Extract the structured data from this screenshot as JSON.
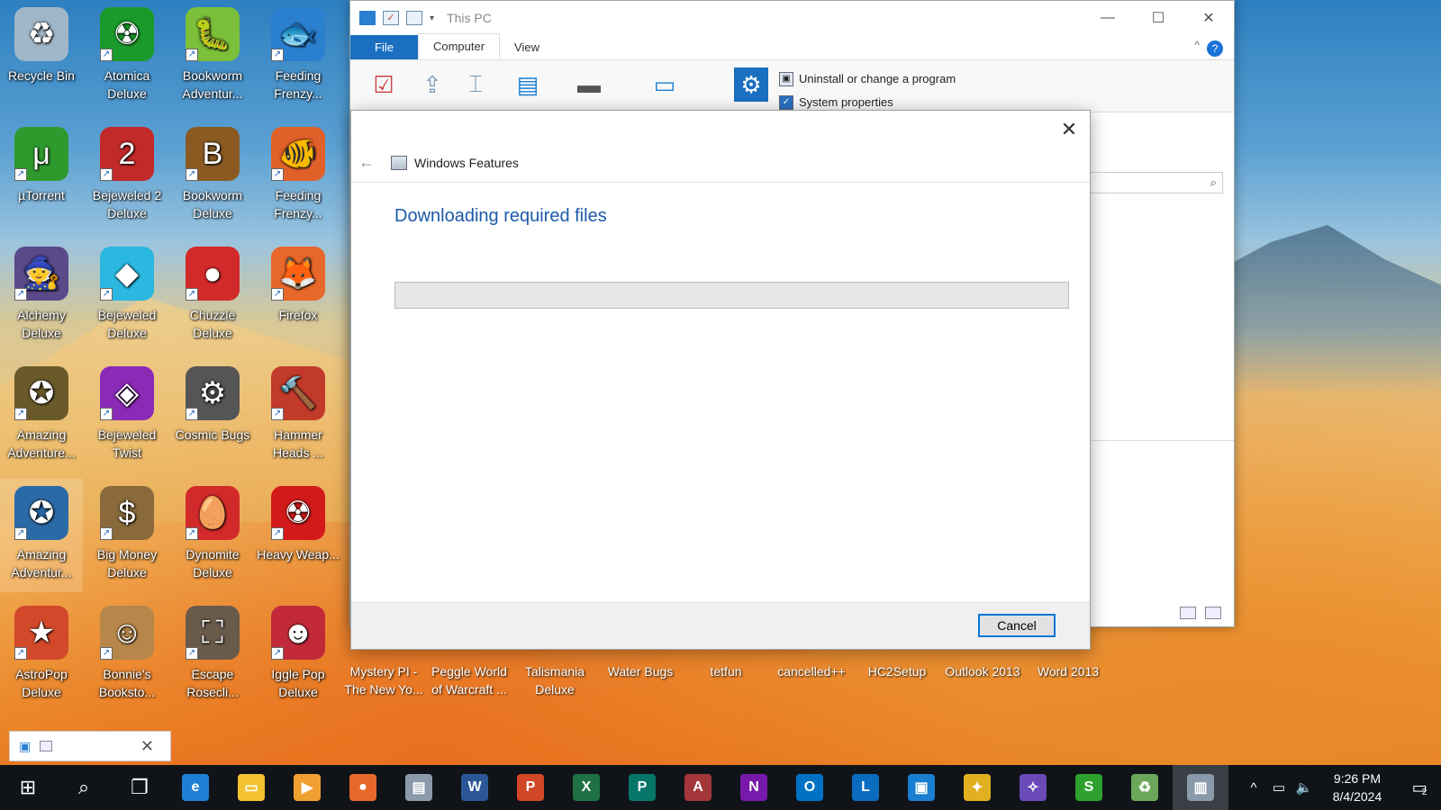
{
  "desktop": {
    "icons": [
      {
        "label": "Recycle Bin",
        "icon": "recycle-bin-icon",
        "color": "#9fb7c9",
        "glyph": "♻",
        "shortcut": false
      },
      {
        "label": "Atomica Deluxe",
        "icon": "atomica-icon",
        "color": "#1a9a2a",
        "glyph": "☢",
        "shortcut": true
      },
      {
        "label": "Bookworm Adventur...",
        "icon": "bookworm-adventures-icon",
        "color": "#7bbf3a",
        "glyph": "🐛",
        "shortcut": true
      },
      {
        "label": "Feeding Frenzy...",
        "icon": "feeding-frenzy-icon",
        "color": "#2a7fcf",
        "glyph": "🐟",
        "shortcut": true
      },
      {
        "label": "µTorrent",
        "icon": "utorrent-icon",
        "color": "#2e9a2e",
        "glyph": "μ",
        "shortcut": true
      },
      {
        "label": "Bejeweled 2 Deluxe",
        "icon": "bejeweled-2-icon",
        "color": "#c22a2a",
        "glyph": "2",
        "shortcut": true
      },
      {
        "label": "Bookworm Deluxe",
        "icon": "bookworm-deluxe-icon",
        "color": "#8a5a22",
        "glyph": "B",
        "shortcut": true
      },
      {
        "label": "Feeding Frenzy...",
        "icon": "feeding-frenzy-2-icon",
        "color": "#e0602a",
        "glyph": "🐠",
        "shortcut": true
      },
      {
        "label": "Alchemy Deluxe",
        "icon": "alchemy-icon",
        "color": "#5a4a8a",
        "glyph": "🧙",
        "shortcut": true
      },
      {
        "label": "Bejeweled Deluxe",
        "icon": "bejeweled-icon",
        "color": "#2ab7e0",
        "glyph": "◆",
        "shortcut": true
      },
      {
        "label": "Chuzzle Deluxe",
        "icon": "chuzzle-icon",
        "color": "#d22a2a",
        "glyph": "●",
        "shortcut": true
      },
      {
        "label": "Firefox",
        "icon": "firefox-icon",
        "color": "#e8672a",
        "glyph": "🦊",
        "shortcut": true
      },
      {
        "label": "Amazing Adventure...",
        "icon": "amazing-adventures-icon",
        "color": "#6a5a2a",
        "glyph": "✪",
        "shortcut": true
      },
      {
        "label": "Bejeweled Twist",
        "icon": "bejeweled-twist-icon",
        "color": "#8a2ab7",
        "glyph": "◈",
        "shortcut": true
      },
      {
        "label": "Cosmic Bugs",
        "icon": "cosmic-bugs-icon",
        "color": "#555555",
        "glyph": "⚙",
        "shortcut": true
      },
      {
        "label": "Hammer Heads ...",
        "icon": "hammer-heads-icon",
        "color": "#c23a2a",
        "glyph": "🔨",
        "shortcut": true
      },
      {
        "label": "Amazing Adventur...",
        "icon": "amazing-adventures-2-icon",
        "color": "#2a6aa7",
        "glyph": "✪",
        "shortcut": true
      },
      {
        "label": "Big Money Deluxe",
        "icon": "big-money-icon",
        "color": "#8a6a3a",
        "glyph": "$",
        "shortcut": true
      },
      {
        "label": "Dynomite Deluxe",
        "icon": "dynomite-icon",
        "color": "#d22a2a",
        "glyph": "🥚",
        "shortcut": true
      },
      {
        "label": "Heavy Weap...",
        "icon": "heavy-weapon-icon",
        "color": "#d21a1a",
        "glyph": "☢",
        "shortcut": true
      },
      {
        "label": "AstroPop Deluxe",
        "icon": "astropop-icon",
        "color": "#d2482a",
        "glyph": "★",
        "shortcut": true
      },
      {
        "label": "Bonnie's Booksto...",
        "icon": "bonnies-bookstore-icon",
        "color": "#b7864a",
        "glyph": "☺",
        "shortcut": true
      },
      {
        "label": "Escape Rosecli...",
        "icon": "escape-rosecliff-icon",
        "color": "#6a5a4a",
        "glyph": "⛶",
        "shortcut": true
      },
      {
        "label": "Iggle Pop Deluxe",
        "icon": "iggle-pop-icon",
        "color": "#c22a3a",
        "glyph": "☻",
        "shortcut": true
      }
    ],
    "bottom_row": [
      "Mystery PI - The New Yo...",
      "Peggle World of Warcraft ...",
      "Talismania Deluxe",
      "Water Bugs",
      "tetfun",
      "cancelled++",
      "HC2Setup",
      "Outlook 2013",
      "Word 2013"
    ]
  },
  "explorer": {
    "title": "This PC",
    "tabs": [
      "File",
      "Computer",
      "View"
    ],
    "active_tab": "Computer",
    "ribbon_links": [
      "Uninstall or change a program",
      "System properties"
    ]
  },
  "dialog": {
    "title": "Windows Features",
    "heading": "Downloading required files",
    "progress": 0,
    "cancel_label": "Cancel"
  },
  "taskbar": {
    "apps": [
      {
        "name": "internet-explorer-icon",
        "color": "#1e7fd6",
        "glyph": "e"
      },
      {
        "name": "file-explorer-icon",
        "color": "#f2c230",
        "glyph": "▭"
      },
      {
        "name": "media-player-icon",
        "color": "#f0a030",
        "glyph": "▶"
      },
      {
        "name": "firefox-icon",
        "color": "#e8672a",
        "glyph": "●"
      },
      {
        "name": "system-monitor-icon",
        "color": "#8a9aaa",
        "glyph": "▤"
      },
      {
        "name": "word-icon",
        "color": "#2b5797",
        "glyph": "W"
      },
      {
        "name": "powerpoint-icon",
        "color": "#d24726",
        "glyph": "P"
      },
      {
        "name": "excel-icon",
        "color": "#1e7145",
        "glyph": "X"
      },
      {
        "name": "publisher-icon",
        "color": "#077568",
        "glyph": "P"
      },
      {
        "name": "access-icon",
        "color": "#a4373a",
        "glyph": "A"
      },
      {
        "name": "onenote-icon",
        "color": "#7719aa",
        "glyph": "N"
      },
      {
        "name": "outlook-icon",
        "color": "#0072c6",
        "glyph": "O"
      },
      {
        "name": "lync-icon",
        "color": "#0a6cbf",
        "glyph": "L"
      },
      {
        "name": "virtualbox-icon",
        "color": "#1a7fd0",
        "glyph": "▣"
      },
      {
        "name": "game-icon",
        "color": "#e0b020",
        "glyph": "✦"
      },
      {
        "name": "bird-app-icon",
        "color": "#6a4ab7",
        "glyph": "✧"
      },
      {
        "name": "s-app-icon",
        "color": "#2ea02e",
        "glyph": "S"
      },
      {
        "name": "recycle-app-icon",
        "color": "#6aa75a",
        "glyph": "♻"
      },
      {
        "name": "windows-features-icon",
        "color": "#8a9aaa",
        "glyph": "▥"
      }
    ],
    "time": "9:26 PM",
    "date": "8/4/2024",
    "notification_count": "2"
  }
}
